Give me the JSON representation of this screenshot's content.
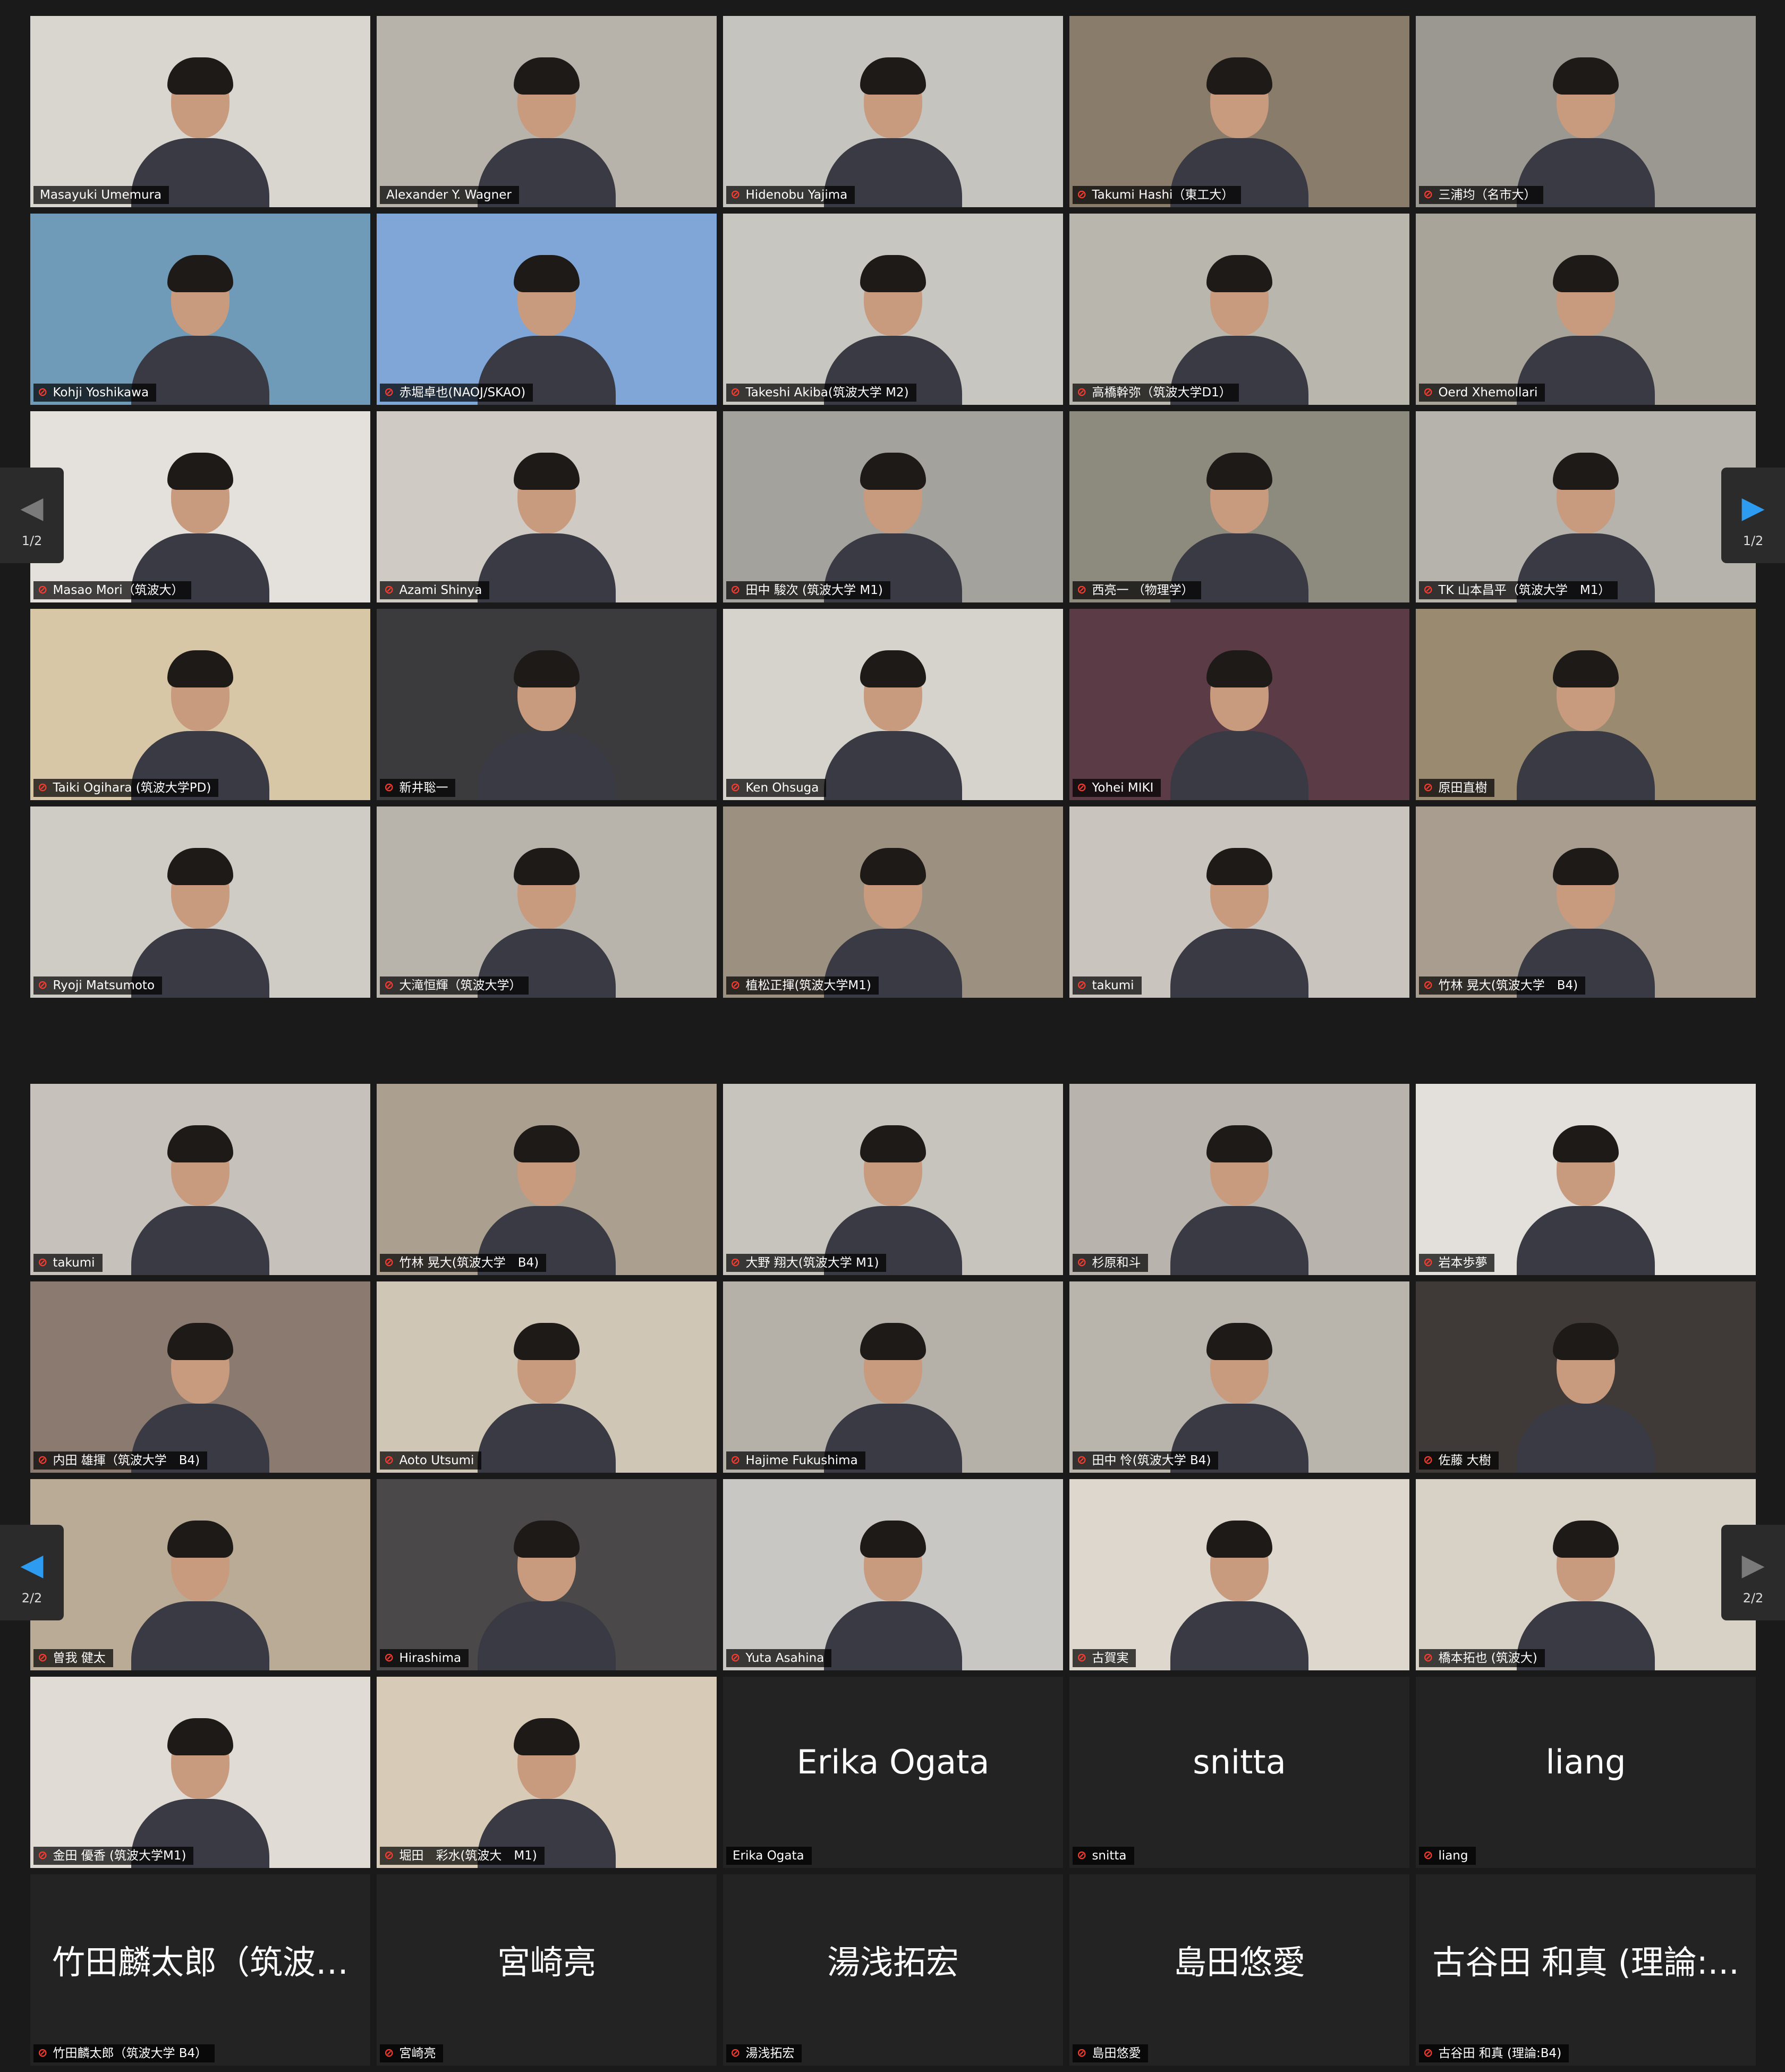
{
  "colors": {
    "accent_speaker": "#d9e36b",
    "muted_mic": "#ff3b30",
    "nav_active": "#2d9bf0",
    "tile_bg": "#232323"
  },
  "mic_glyph": "⊘",
  "panels": [
    {
      "nav_left": {
        "icon": "chevron-left-icon",
        "glyph": "◀",
        "state": "dim",
        "page": "1/2"
      },
      "nav_right": {
        "icon": "chevron-right-icon",
        "glyph": "▶",
        "state": "hi",
        "page": "1/2"
      },
      "tiles": [
        {
          "label": "Masayuki Umemura",
          "muted": false,
          "active": true,
          "bg": "#d9d6cf"
        },
        {
          "label": "Alexander Y. Wagner",
          "muted": false,
          "bg": "#b7b2aa"
        },
        {
          "label": "Hidenobu Yajima",
          "muted": true,
          "bg": "#c6c4bf"
        },
        {
          "label": "Takumi Hashi（東工大）",
          "muted": true,
          "bg": "#8a7c6a"
        },
        {
          "label": "三浦均（名市大）",
          "muted": true,
          "bg": "#9a9890"
        },
        {
          "label": "Kohji Yoshikawa",
          "muted": true,
          "bg": "#6f9bb8"
        },
        {
          "label": "赤堀卓也(NAOJ/SKAO)",
          "muted": true,
          "bg": "#7fa6d6"
        },
        {
          "label": "Takeshi Akiba(筑波大学 M2)",
          "muted": true,
          "bg": "#c8c6c0"
        },
        {
          "label": "高橋幹弥（筑波大学D1）",
          "muted": true,
          "bg": "#b9b6ae"
        },
        {
          "label": "Oerd Xhemollari",
          "muted": true,
          "bg": "#a9a49a"
        },
        {
          "label": "Masao Mori（筑波大）",
          "muted": true,
          "bg": "#e4e1dc"
        },
        {
          "label": "Azami Shinya",
          "muted": true,
          "bg": "#cfcbc4"
        },
        {
          "label": "田中 駿次 (筑波大学 M1)",
          "muted": true,
          "bg": "#a4a29c"
        },
        {
          "label": "西亮一 （物理学）",
          "muted": true,
          "bg": "#8d8a7e"
        },
        {
          "label": "TK 山本昌平（筑波大学　M1）",
          "muted": true,
          "bg": "#b6b3ac"
        },
        {
          "label": "Taiki Ogihara (筑波大学PD)",
          "muted": true,
          "bg": "#d8c7a6"
        },
        {
          "label": "新井聡一",
          "muted": true,
          "bg": "#3b3b3d"
        },
        {
          "label": "Ken Ohsuga",
          "muted": true,
          "bg": "#d6d3cc"
        },
        {
          "label": "Yohei MIKI",
          "muted": true,
          "bg": "#5b3b45"
        },
        {
          "label": "原田直樹",
          "muted": true,
          "bg": "#9a8a70"
        },
        {
          "label": "Ryoji Matsumoto",
          "muted": true,
          "bg": "#cfccc6"
        },
        {
          "label": "大滝恒輝（筑波大学）",
          "muted": true,
          "bg": "#b8b4ac"
        },
        {
          "label": "植松正揮(筑波大学M1)",
          "muted": true,
          "bg": "#9c9080"
        },
        {
          "label": "takumi",
          "muted": true,
          "bg": "#c9c5be"
        },
        {
          "label": "竹林 晃大(筑波大学　B4)",
          "muted": true,
          "bg": "#a89d8e"
        }
      ]
    },
    {
      "nav_left": {
        "icon": "chevron-left-icon",
        "glyph": "◀",
        "state": "hi",
        "page": "2/2"
      },
      "nav_right": {
        "icon": "chevron-right-icon",
        "glyph": "▶",
        "state": "dim",
        "page": "2/2"
      },
      "tiles": [
        {
          "label": "takumi",
          "muted": true,
          "bg": "#c6c2bb"
        },
        {
          "label": "竹林 晃大(筑波大学　B4)",
          "muted": true,
          "bg": "#ab9f8f"
        },
        {
          "label": "大野 翔大(筑波大学 M1)",
          "muted": true,
          "bg": "#c7c4bd"
        },
        {
          "label": "杉原和斗",
          "muted": true,
          "bg": "#b8b4ad"
        },
        {
          "label": "岩本歩夢",
          "muted": true,
          "bg": "#e3e0db"
        },
        {
          "label": "内田 雄揮（筑波大学　B4)",
          "muted": true,
          "bg": "#8a7a70"
        },
        {
          "label": "Aoto Utsumi",
          "muted": true,
          "bg": "#cfc6b6"
        },
        {
          "label": "Hajime Fukushima",
          "muted": true,
          "bg": "#b5b1a9"
        },
        {
          "label": "田中 怜(筑波大学 B4)",
          "muted": true,
          "bg": "#b9b5ad"
        },
        {
          "label": "佐藤 大樹",
          "muted": true,
          "bg": "#3f3a38"
        },
        {
          "label": "曽我 健太",
          "muted": true,
          "bg": "#b9ab96"
        },
        {
          "label": "Hirashima",
          "muted": true,
          "bg": "#4a4848"
        },
        {
          "label": "Yuta Asahina",
          "muted": true,
          "bg": "#c9c7c3"
        },
        {
          "label": "古賀実",
          "muted": true,
          "bg": "#ddd7cd"
        },
        {
          "label": "橋本拓也 (筑波大)",
          "muted": true,
          "bg": "#d8d2c6"
        },
        {
          "label": "金田 優香 (筑波大学M1)",
          "muted": true,
          "bg": "#e0dbd4"
        },
        {
          "label": "堀田　彩水(筑波大　M1)",
          "muted": true,
          "bg": "#d7cbb8"
        },
        {
          "label": "Erika Ogata",
          "muted": false,
          "bg": "#232323",
          "bigname": "Erika Ogata"
        },
        {
          "label": "snitta",
          "muted": true,
          "bg": "#232323",
          "bigname": "snitta"
        },
        {
          "label": "liang",
          "muted": true,
          "bg": "#232323",
          "bigname": "liang"
        },
        {
          "label": "竹田麟太郎（筑波大学 B4）",
          "muted": true,
          "bg": "#232323",
          "bigname": "竹田麟太郎（筑波…"
        },
        {
          "label": "宮崎亮",
          "muted": true,
          "bg": "#232323",
          "bigname": "宮崎亮"
        },
        {
          "label": "湯浅拓宏",
          "muted": true,
          "bg": "#232323",
          "bigname": "湯浅拓宏"
        },
        {
          "label": "島田悠愛",
          "muted": true,
          "bg": "#232323",
          "bigname": "島田悠愛"
        },
        {
          "label": "古谷田 和真 (理論:B4)",
          "muted": true,
          "bg": "#232323",
          "bigname": "古谷田 和真 (理論:..."
        }
      ]
    }
  ]
}
